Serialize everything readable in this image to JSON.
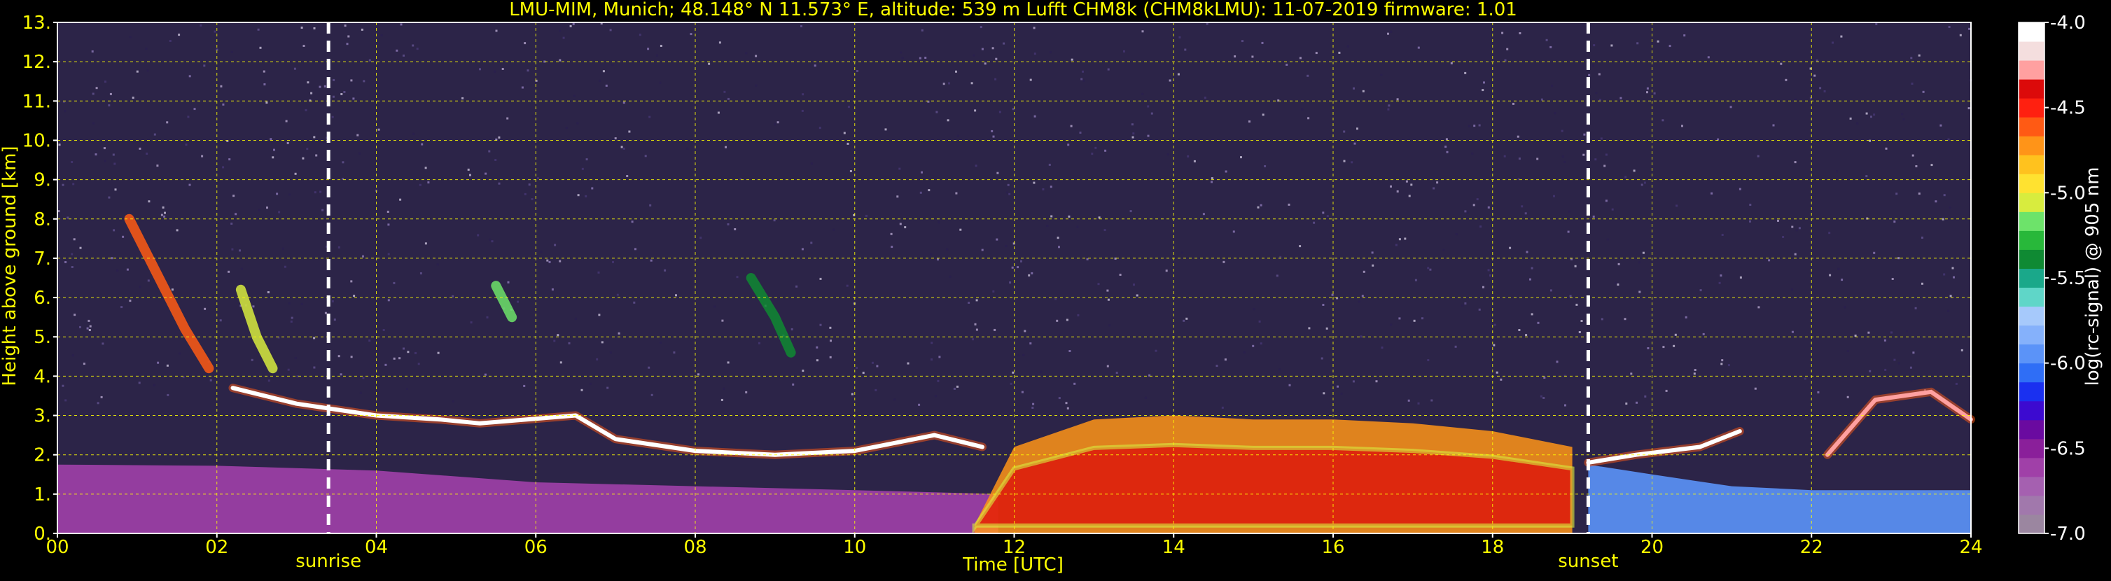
{
  "chart_data": {
    "type": "heatmap",
    "title": "LMU-MIM, Munich; 48.148° N 11.573° E, altitude: 539 m    Lufft CHM8k (CHM8kLMU): 11-07-2019    firmware: 1.01",
    "xlabel": "Time [UTC]",
    "ylabel": "Height above ground [km]",
    "xlim": [
      0,
      24
    ],
    "ylim": [
      0,
      13
    ],
    "x_ticks": [
      0,
      2,
      4,
      6,
      8,
      10,
      12,
      14,
      16,
      18,
      20,
      22,
      24
    ],
    "x_tick_labels": [
      "00",
      "02",
      "04",
      "06",
      "08",
      "10",
      "12",
      "14",
      "16",
      "18",
      "20",
      "22",
      "24"
    ],
    "y_ticks": [
      0,
      1,
      2,
      3,
      4,
      5,
      6,
      7,
      8,
      9,
      10,
      11,
      12,
      13
    ],
    "y_tick_labels": [
      "0.",
      "1.",
      "2.",
      "3.",
      "4.",
      "5.",
      "6.",
      "7.",
      "8.",
      "9.",
      "10.",
      "11.",
      "12.",
      "13."
    ],
    "grid": true,
    "grid_color": "#ffff00",
    "text_color": "#ffff00",
    "background": "#000000",
    "plot_background": "#2c2448",
    "annotations": [
      {
        "label": "sunrise",
        "x": 3.4
      },
      {
        "label": "sunset",
        "x": 19.2
      }
    ],
    "colorbar": {
      "label": "log(rc-signal) @ 905 nm",
      "range": [
        -7.0,
        -4.0
      ],
      "ticks": [
        -7.0,
        -6.5,
        -6.0,
        -5.5,
        -5.0,
        -4.5,
        -4.0
      ],
      "tick_labels": [
        "-7.0",
        "-6.5",
        "-6.0",
        "-5.5",
        "-5.0",
        "-4.5",
        "-4.0"
      ],
      "colors": [
        "#9b86a0",
        "#a178ac",
        "#a560b0",
        "#a040a8",
        "#8a1f9a",
        "#6a0aa0",
        "#3c0ad0",
        "#1a30f0",
        "#2f6ef6",
        "#5b93f8",
        "#85b1fb",
        "#a6c9fb",
        "#5fd6c8",
        "#1aa88a",
        "#0f8a33",
        "#28b83a",
        "#6de36a",
        "#d8ec3e",
        "#ffe230",
        "#ffc21e",
        "#ff9418",
        "#ff5a14",
        "#ff2010",
        "#dc0a0a",
        "#ffa0a0",
        "#f4dede",
        "#ffffff"
      ]
    },
    "features": [
      {
        "type": "aerosol_layer",
        "points": [
          [
            0,
            1.75
          ],
          [
            2,
            1.72
          ],
          [
            4,
            1.6
          ],
          [
            6,
            1.3
          ],
          [
            8,
            1.2
          ],
          [
            10,
            1.1
          ],
          [
            11.8,
            1.0
          ]
        ],
        "value": -6.6
      },
      {
        "type": "convective_layer",
        "points": [
          [
            11.5,
            0.2
          ],
          [
            12,
            2.2
          ],
          [
            13,
            2.9
          ],
          [
            14,
            3.0
          ],
          [
            15,
            2.9
          ],
          [
            16,
            2.9
          ],
          [
            17,
            2.8
          ],
          [
            18,
            2.6
          ],
          [
            19,
            2.2
          ]
        ],
        "value": -4.7
      },
      {
        "type": "nocturnal_layer",
        "points": [
          [
            19.2,
            1.75
          ],
          [
            20,
            1.5
          ],
          [
            21,
            1.2
          ],
          [
            22,
            1.1
          ],
          [
            23,
            1.1
          ],
          [
            24,
            1.1
          ]
        ],
        "value": -6.0
      },
      {
        "type": "cloud_base",
        "points": [
          [
            2.2,
            3.7
          ],
          [
            3,
            3.3
          ],
          [
            4,
            3.0
          ],
          [
            4.8,
            2.9
          ],
          [
            5.3,
            2.8
          ],
          [
            6.5,
            3.0
          ],
          [
            7,
            2.4
          ],
          [
            8,
            2.1
          ],
          [
            9,
            2.0
          ],
          [
            10,
            2.1
          ],
          [
            11,
            2.5
          ],
          [
            11.6,
            2.2
          ]
        ],
        "value": -4.0
      },
      {
        "type": "cloud_base",
        "points": [
          [
            19.2,
            1.8
          ],
          [
            19.8,
            2.0
          ],
          [
            20.6,
            2.2
          ],
          [
            21.1,
            2.6
          ]
        ],
        "value": -4.0
      },
      {
        "type": "cloud_base",
        "points": [
          [
            22.2,
            2.0
          ],
          [
            22.8,
            3.4
          ],
          [
            23.5,
            3.6
          ],
          [
            24,
            2.9
          ]
        ],
        "value": -4.2
      },
      {
        "type": "virga",
        "points": [
          [
            0.9,
            8.0
          ],
          [
            1.2,
            6.8
          ],
          [
            1.6,
            5.2
          ],
          [
            1.9,
            4.2
          ]
        ],
        "value": -4.6
      },
      {
        "type": "virga",
        "points": [
          [
            2.3,
            6.2
          ],
          [
            2.5,
            5.0
          ],
          [
            2.7,
            4.2
          ]
        ],
        "value": -5.0
      },
      {
        "type": "virga",
        "points": [
          [
            5.5,
            6.3
          ],
          [
            5.7,
            5.5
          ]
        ],
        "value": -5.1
      },
      {
        "type": "virga",
        "points": [
          [
            8.7,
            6.5
          ],
          [
            9.0,
            5.5
          ],
          [
            9.2,
            4.6
          ]
        ],
        "value": -5.4
      }
    ]
  }
}
